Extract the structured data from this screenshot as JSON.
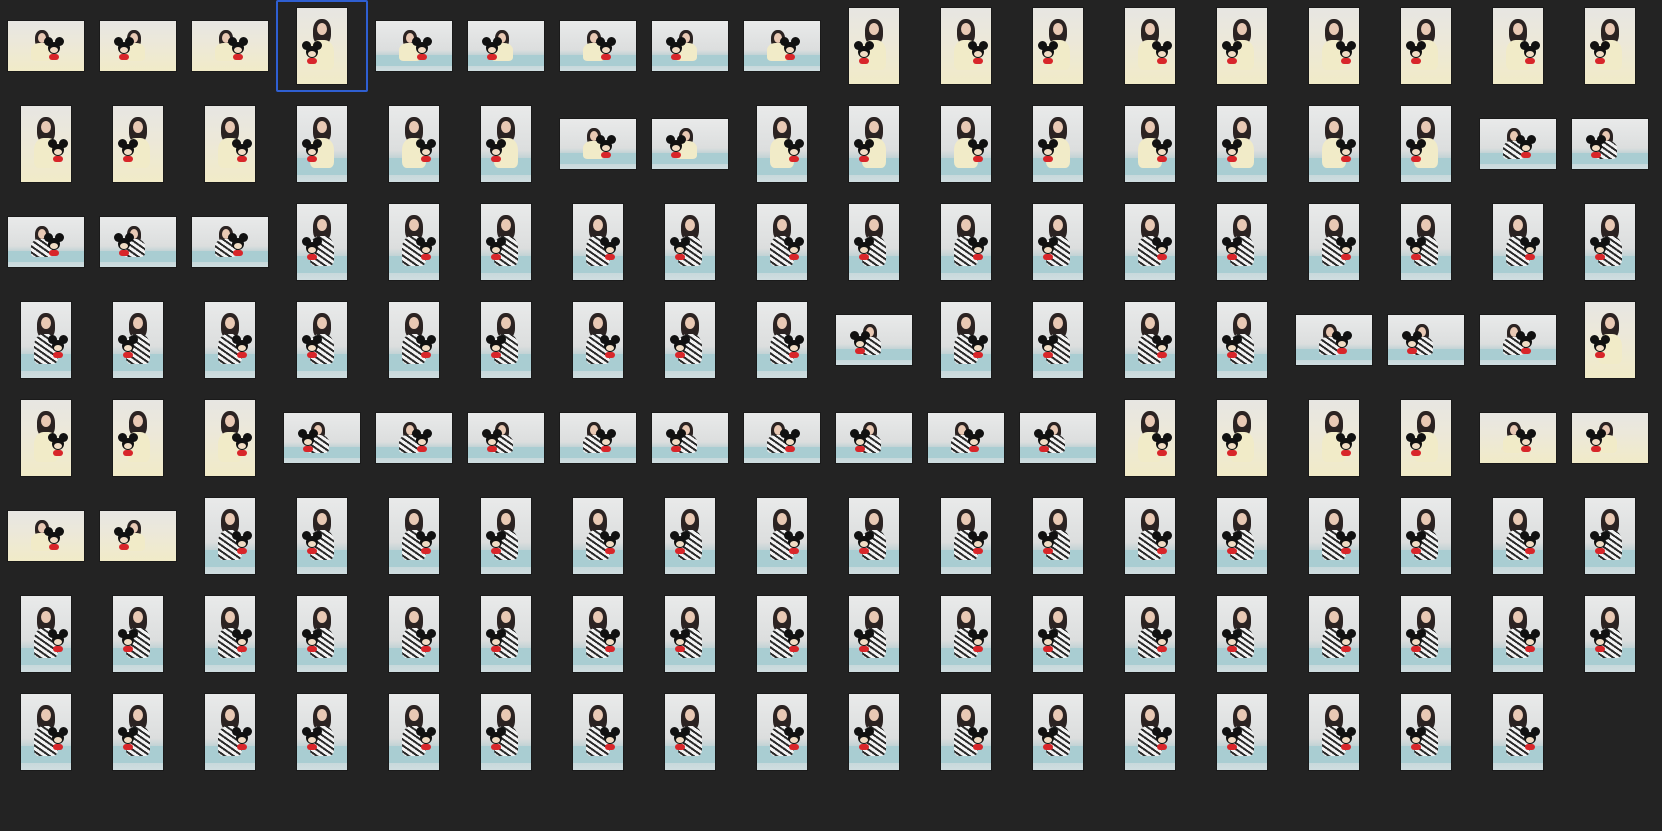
{
  "window": {
    "background": "#232323",
    "selection_color": "#2f5fd1",
    "view": "thumbnail-grid"
  },
  "grid": {
    "columns": 18,
    "rows": 8,
    "selected_index": 3
  },
  "thumbnails": [
    {
      "o": "l",
      "t": "s"
    },
    {
      "o": "l",
      "t": "s"
    },
    {
      "o": "l",
      "t": "s"
    },
    {
      "o": "p",
      "t": "s"
    },
    {
      "o": "l",
      "t": "c"
    },
    {
      "o": "l",
      "t": "c"
    },
    {
      "o": "l",
      "t": "c"
    },
    {
      "o": "l",
      "t": "c"
    },
    {
      "o": "l",
      "t": "c"
    },
    {
      "o": "p",
      "t": "s"
    },
    {
      "o": "p",
      "t": "s"
    },
    {
      "o": "p",
      "t": "s"
    },
    {
      "o": "p",
      "t": "s"
    },
    {
      "o": "p",
      "t": "s"
    },
    {
      "o": "p",
      "t": "s"
    },
    {
      "o": "p",
      "t": "s"
    },
    {
      "o": "p",
      "t": "s"
    },
    {
      "o": "p",
      "t": "s"
    },
    {
      "o": "p",
      "t": "s"
    },
    {
      "o": "p",
      "t": "s"
    },
    {
      "o": "p",
      "t": "s"
    },
    {
      "o": "p",
      "t": "c"
    },
    {
      "o": "p",
      "t": "c"
    },
    {
      "o": "p",
      "t": "c"
    },
    {
      "o": "l",
      "t": "c"
    },
    {
      "o": "l",
      "t": "c"
    },
    {
      "o": "p",
      "t": "c"
    },
    {
      "o": "p",
      "t": "c"
    },
    {
      "o": "p",
      "t": "c"
    },
    {
      "o": "p",
      "t": "c"
    },
    {
      "o": "p",
      "t": "c"
    },
    {
      "o": "p",
      "t": "c"
    },
    {
      "o": "p",
      "t": "c"
    },
    {
      "o": "p",
      "t": "c"
    },
    {
      "o": "l",
      "t": "z"
    },
    {
      "o": "l",
      "t": "z"
    },
    {
      "o": "l",
      "t": "z"
    },
    {
      "o": "l",
      "t": "z"
    },
    {
      "o": "l",
      "t": "z"
    },
    {
      "o": "p",
      "t": "z"
    },
    {
      "o": "p",
      "t": "z"
    },
    {
      "o": "p",
      "t": "z"
    },
    {
      "o": "p",
      "t": "z"
    },
    {
      "o": "p",
      "t": "z"
    },
    {
      "o": "p",
      "t": "z"
    },
    {
      "o": "p",
      "t": "z"
    },
    {
      "o": "p",
      "t": "z"
    },
    {
      "o": "p",
      "t": "z"
    },
    {
      "o": "p",
      "t": "z"
    },
    {
      "o": "p",
      "t": "z"
    },
    {
      "o": "p",
      "t": "z"
    },
    {
      "o": "p",
      "t": "z"
    },
    {
      "o": "p",
      "t": "z"
    },
    {
      "o": "p",
      "t": "z"
    },
    {
      "o": "p",
      "t": "z"
    },
    {
      "o": "p",
      "t": "z"
    },
    {
      "o": "p",
      "t": "z"
    },
    {
      "o": "p",
      "t": "z"
    },
    {
      "o": "p",
      "t": "z"
    },
    {
      "o": "p",
      "t": "z"
    },
    {
      "o": "p",
      "t": "z"
    },
    {
      "o": "p",
      "t": "z"
    },
    {
      "o": "p",
      "t": "z"
    },
    {
      "o": "l",
      "t": "z"
    },
    {
      "o": "p",
      "t": "z"
    },
    {
      "o": "p",
      "t": "z"
    },
    {
      "o": "p",
      "t": "z"
    },
    {
      "o": "p",
      "t": "z"
    },
    {
      "o": "l",
      "t": "z"
    },
    {
      "o": "l",
      "t": "z"
    },
    {
      "o": "l",
      "t": "z"
    },
    {
      "o": "p",
      "t": "s"
    },
    {
      "o": "p",
      "t": "s"
    },
    {
      "o": "p",
      "t": "s"
    },
    {
      "o": "p",
      "t": "s"
    },
    {
      "o": "l",
      "t": "z"
    },
    {
      "o": "l",
      "t": "z"
    },
    {
      "o": "l",
      "t": "z"
    },
    {
      "o": "l",
      "t": "z"
    },
    {
      "o": "l",
      "t": "z"
    },
    {
      "o": "l",
      "t": "z"
    },
    {
      "o": "l",
      "t": "z"
    },
    {
      "o": "l",
      "t": "z"
    },
    {
      "o": "l",
      "t": "z"
    },
    {
      "o": "p",
      "t": "s"
    },
    {
      "o": "p",
      "t": "s"
    },
    {
      "o": "p",
      "t": "s"
    },
    {
      "o": "p",
      "t": "s"
    },
    {
      "o": "l",
      "t": "s"
    },
    {
      "o": "l",
      "t": "s"
    },
    {
      "o": "l",
      "t": "s"
    },
    {
      "o": "l",
      "t": "s"
    },
    {
      "o": "p",
      "t": "z"
    },
    {
      "o": "p",
      "t": "z"
    },
    {
      "o": "p",
      "t": "z"
    },
    {
      "o": "p",
      "t": "z"
    },
    {
      "o": "p",
      "t": "z"
    },
    {
      "o": "p",
      "t": "z"
    },
    {
      "o": "p",
      "t": "z"
    },
    {
      "o": "p",
      "t": "z"
    },
    {
      "o": "p",
      "t": "z"
    },
    {
      "o": "p",
      "t": "z"
    },
    {
      "o": "p",
      "t": "z"
    },
    {
      "o": "p",
      "t": "z"
    },
    {
      "o": "p",
      "t": "z"
    },
    {
      "o": "p",
      "t": "z"
    },
    {
      "o": "p",
      "t": "z"
    },
    {
      "o": "p",
      "t": "z"
    },
    {
      "o": "p",
      "t": "z"
    },
    {
      "o": "p",
      "t": "z"
    },
    {
      "o": "p",
      "t": "z"
    },
    {
      "o": "p",
      "t": "z"
    },
    {
      "o": "p",
      "t": "z"
    },
    {
      "o": "p",
      "t": "z"
    },
    {
      "o": "p",
      "t": "z"
    },
    {
      "o": "p",
      "t": "z"
    },
    {
      "o": "p",
      "t": "z"
    },
    {
      "o": "p",
      "t": "z"
    },
    {
      "o": "p",
      "t": "z"
    },
    {
      "o": "p",
      "t": "z"
    },
    {
      "o": "p",
      "t": "z"
    },
    {
      "o": "p",
      "t": "z"
    },
    {
      "o": "p",
      "t": "z"
    },
    {
      "o": "p",
      "t": "z"
    },
    {
      "o": "p",
      "t": "z"
    },
    {
      "o": "p",
      "t": "z"
    },
    {
      "o": "p",
      "t": "z"
    },
    {
      "o": "p",
      "t": "z"
    },
    {
      "o": "p",
      "t": "z"
    },
    {
      "o": "p",
      "t": "z"
    },
    {
      "o": "p",
      "t": "z"
    },
    {
      "o": "p",
      "t": "z"
    },
    {
      "o": "p",
      "t": "z"
    },
    {
      "o": "p",
      "t": "z"
    },
    {
      "o": "p",
      "t": "z"
    },
    {
      "o": "p",
      "t": "z"
    },
    {
      "o": "p",
      "t": "z"
    },
    {
      "o": "p",
      "t": "z"
    },
    {
      "o": "p",
      "t": "z"
    },
    {
      "o": "p",
      "t": "z"
    },
    {
      "o": "p",
      "t": "z"
    },
    {
      "o": "p",
      "t": "z"
    },
    {
      "o": "p",
      "t": "z"
    }
  ]
}
